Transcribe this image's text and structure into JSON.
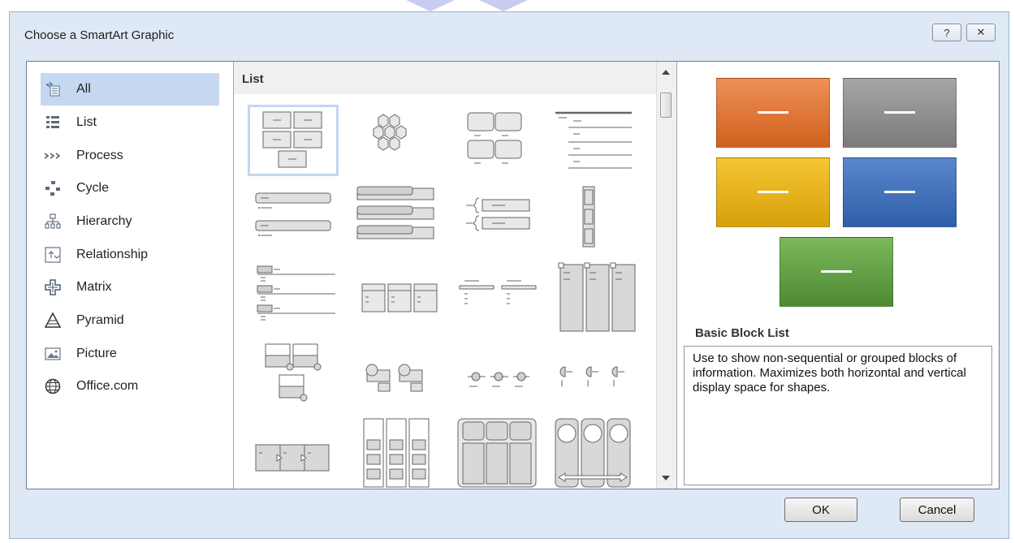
{
  "dialog": {
    "title": "Choose a SmartArt Graphic",
    "help_label": "?",
    "close_label": "✕"
  },
  "categories": [
    {
      "label": "All",
      "icon": "all-icon",
      "selected": true
    },
    {
      "label": "List",
      "icon": "list-icon"
    },
    {
      "label": "Process",
      "icon": "process-icon"
    },
    {
      "label": "Cycle",
      "icon": "cycle-icon"
    },
    {
      "label": "Hierarchy",
      "icon": "hierarchy-icon"
    },
    {
      "label": "Relationship",
      "icon": "relationship-icon"
    },
    {
      "label": "Matrix",
      "icon": "matrix-icon"
    },
    {
      "label": "Pyramid",
      "icon": "pyramid-icon"
    },
    {
      "label": "Picture",
      "icon": "picture-icon"
    },
    {
      "label": "Office.com",
      "icon": "globe-icon"
    }
  ],
  "gallery": {
    "section_title": "List",
    "thumbnails": [
      "basic-block-list",
      "hexagon-list",
      "grouped-block-list",
      "lined-list",
      "bullet-list-a",
      "bullet-list-b",
      "bracket-list",
      "vertical-box-list",
      "lined-bullet-list",
      "table-list",
      "hierarchy-list",
      "vertical-bullet-columns",
      "picture-caption-list",
      "circle-label-list",
      "dot-list",
      "pie-label-list",
      "arrow-process-list",
      "stacked-list",
      "horizontal-block-list",
      "circle-arrow-list"
    ]
  },
  "preview": {
    "name": "Basic Block List",
    "description": "Use to show non-sequential or grouped blocks of information. Maximizes both horizontal and vertical display space for shapes.",
    "colors": {
      "orange": "#dc6a24",
      "gray": "#8c8c8c",
      "yellow": "#e3ad16",
      "blue": "#3a69b4",
      "green": "#5c9a3e"
    }
  },
  "buttons": {
    "ok": "OK",
    "cancel": "Cancel"
  }
}
